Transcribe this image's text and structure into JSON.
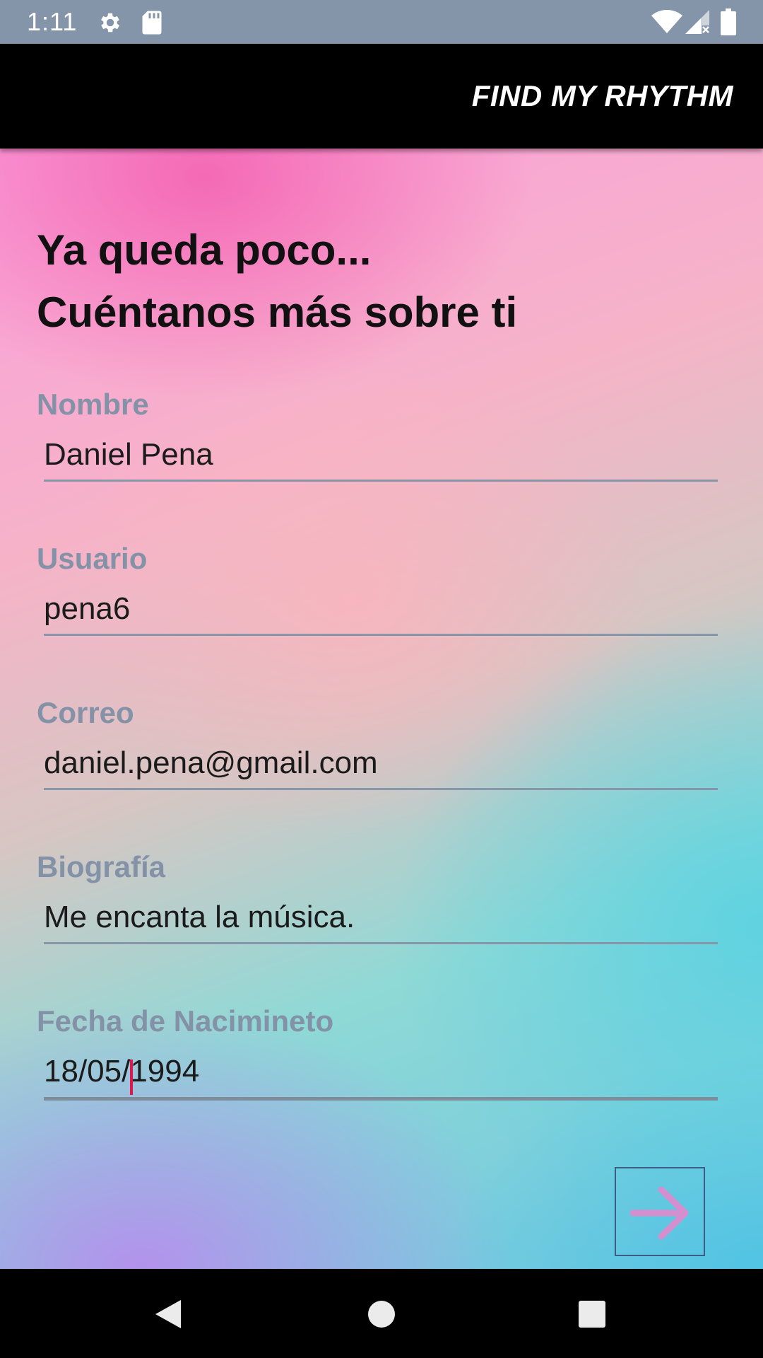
{
  "status_bar": {
    "time": "1:11",
    "icons": [
      "gear-icon",
      "sd-card-icon",
      "wifi-icon",
      "signal-icon",
      "battery-icon"
    ]
  },
  "app_bar": {
    "title": "FIND MY RHYTHM"
  },
  "heading": {
    "line1": "Ya queda poco...",
    "line2": "Cuéntanos más sobre ti"
  },
  "form": {
    "nombre": {
      "label": "Nombre",
      "value": "Daniel Pena"
    },
    "usuario": {
      "label": "Usuario",
      "value": "pena6"
    },
    "correo": {
      "label": "Correo",
      "value": "daniel.pena@gmail.com"
    },
    "biografia": {
      "label": "Biografía",
      "value": "Me encanta la música."
    },
    "fecha": {
      "label": "Fecha de Nacimineto",
      "value": "18/05/1994"
    }
  },
  "next_button": {
    "icon": "arrow-right-icon"
  },
  "nav_bar": {
    "icons": [
      "back-icon",
      "home-icon",
      "recents-icon"
    ]
  },
  "colors": {
    "label": "#8392a6",
    "caret": "#e0164f",
    "arrow": "#d58fce",
    "button_border": "#3a5c86"
  }
}
